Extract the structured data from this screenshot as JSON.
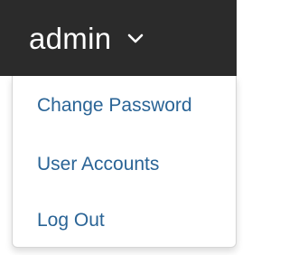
{
  "navbar": {
    "user_label": "admin",
    "caret_icon": "chevron-down-icon",
    "background": "#2b2b2b",
    "text_color": "#ffffff"
  },
  "dropdown": {
    "link_color": "#2a6496",
    "items": [
      {
        "label": "Change Password"
      },
      {
        "label": "User Accounts"
      },
      {
        "label": "Log Out"
      }
    ]
  }
}
